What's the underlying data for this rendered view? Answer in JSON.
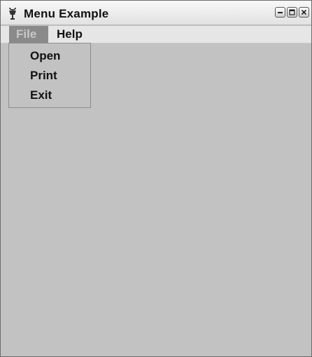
{
  "window": {
    "title": "Menu Example",
    "icon": "applet-icon",
    "controls": [
      "minimize-icon",
      "maximize-icon",
      "close-icon"
    ]
  },
  "menubar": {
    "items": [
      {
        "label": "File",
        "state": "open"
      },
      {
        "label": "Help"
      }
    ]
  },
  "file_menu": {
    "items": [
      {
        "label": "Open"
      },
      {
        "label": "Print"
      },
      {
        "label": "Exit"
      }
    ]
  },
  "colors": {
    "window_background": "#c2c2c2",
    "menubar_background": "#e6e6e6",
    "selected_menu_background": "#8a8a8a",
    "selected_menu_text": "#c8c8c8"
  }
}
